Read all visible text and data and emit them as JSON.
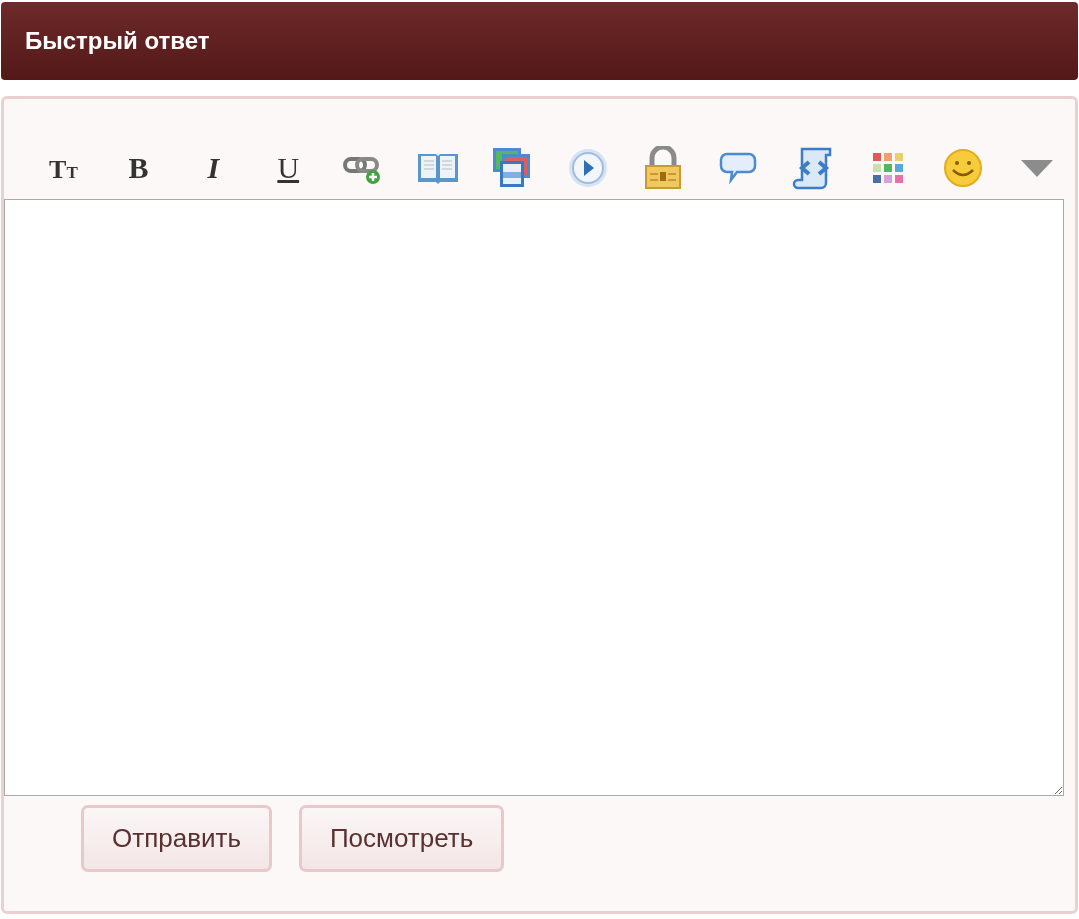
{
  "header": {
    "title": "Быстрый ответ"
  },
  "toolbar": [
    {
      "kind": "fontsize",
      "label": "TT"
    },
    {
      "kind": "bold",
      "label": "B"
    },
    {
      "kind": "italic",
      "label": "I"
    },
    {
      "kind": "underline",
      "label": "U"
    },
    {
      "kind": "link"
    },
    {
      "kind": "book"
    },
    {
      "kind": "gallery"
    },
    {
      "kind": "play"
    },
    {
      "kind": "lock"
    },
    {
      "kind": "speech"
    },
    {
      "kind": "code"
    },
    {
      "kind": "palette"
    },
    {
      "kind": "smiley"
    },
    {
      "kind": "more"
    }
  ],
  "buttons": [
    {
      "label": "Отправить"
    },
    {
      "label": "Посмотреть"
    }
  ]
}
